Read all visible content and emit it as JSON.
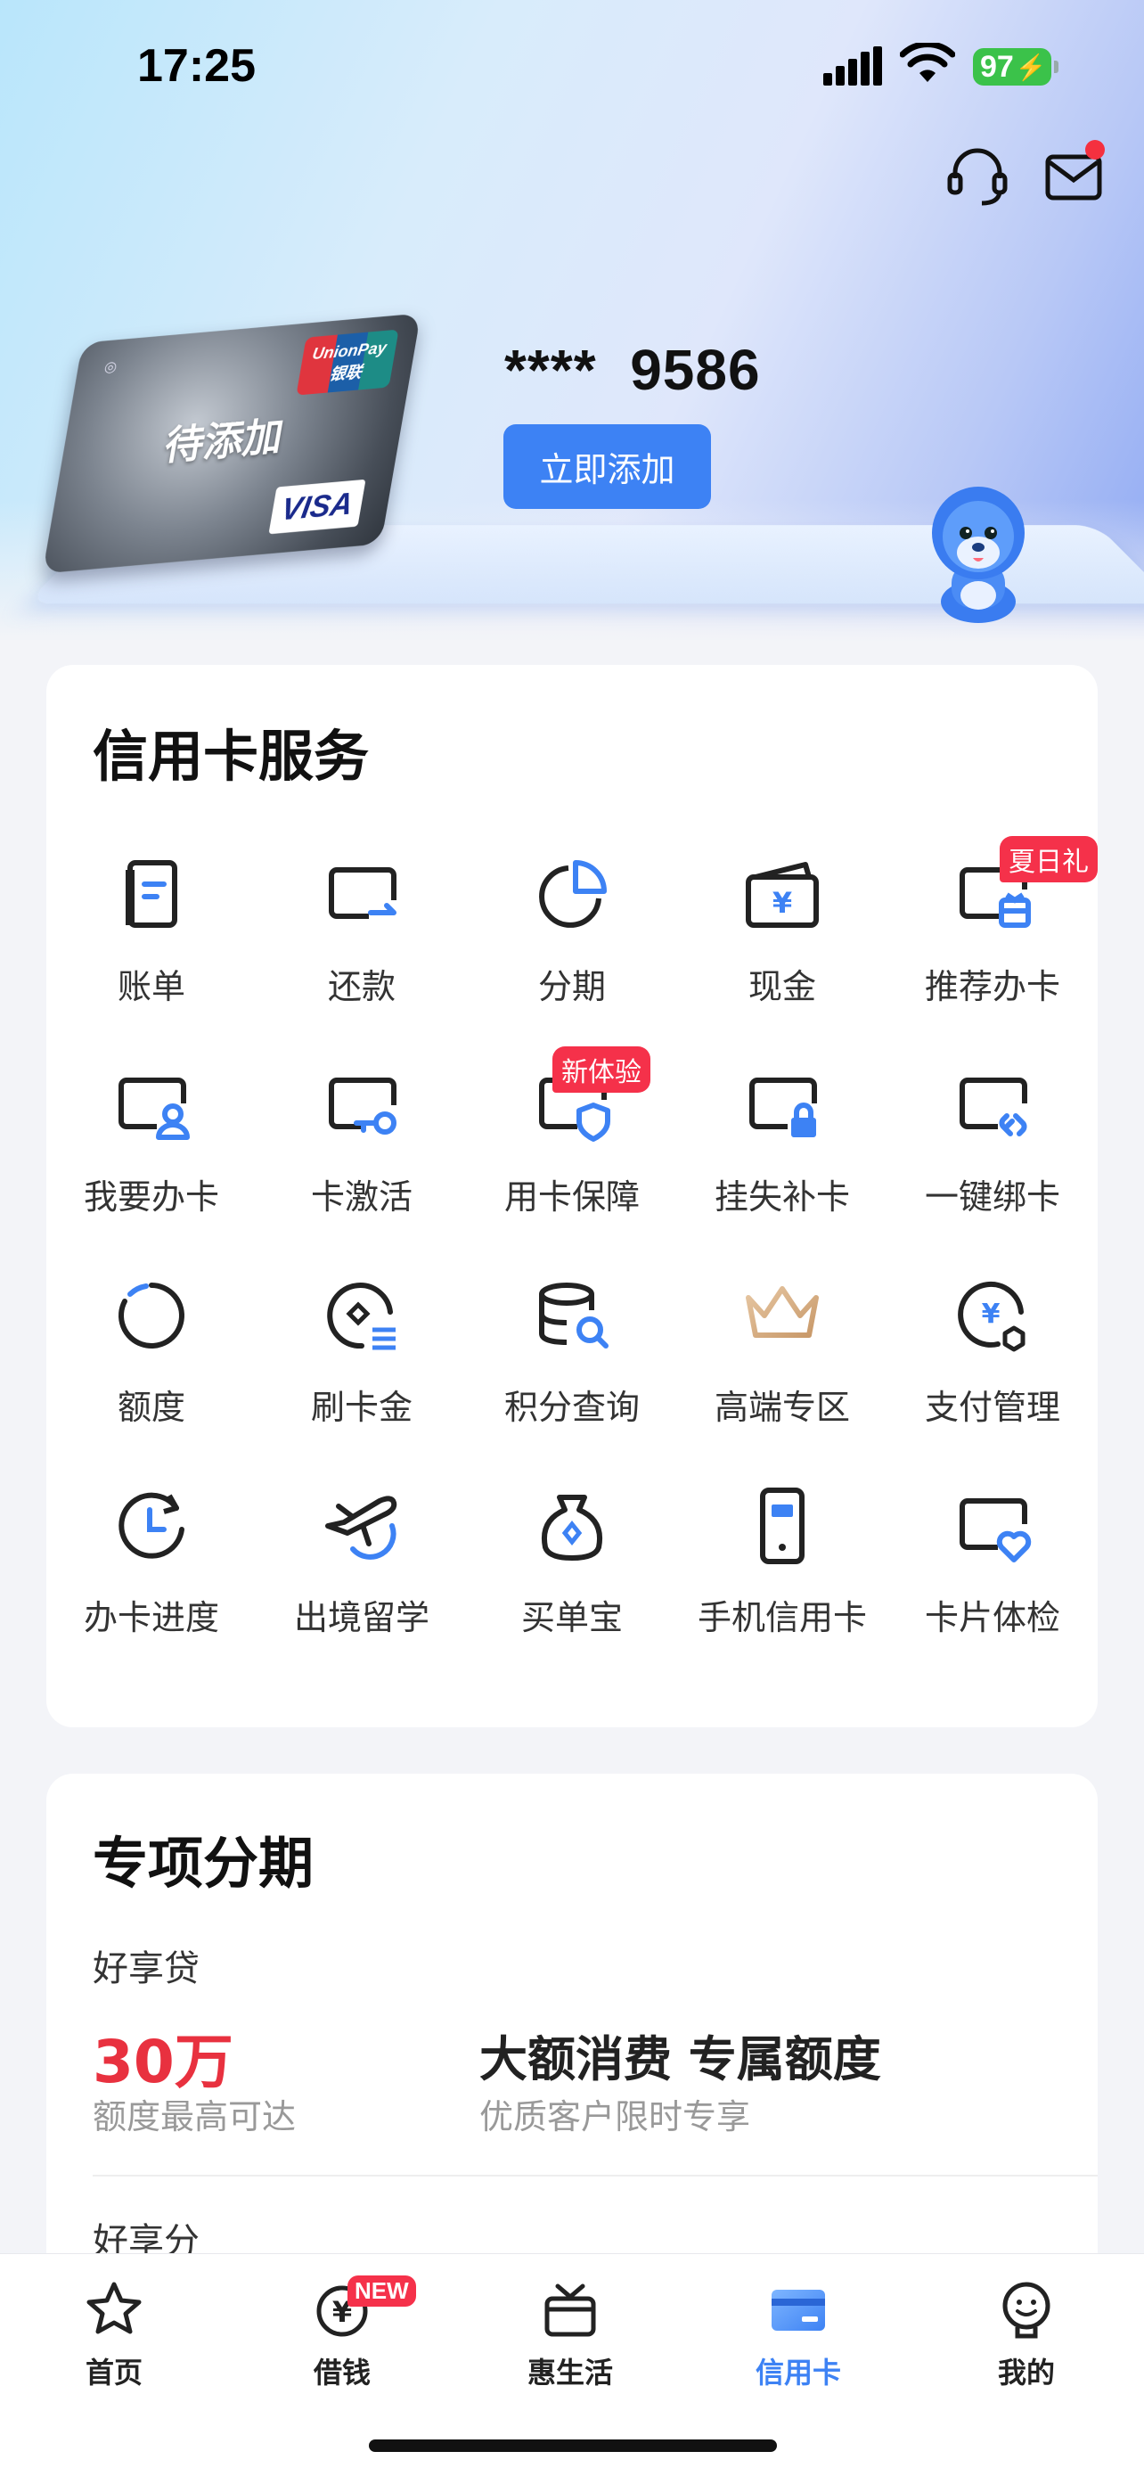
{
  "status_bar": {
    "time": "17:25",
    "battery": "97"
  },
  "header": {
    "support_icon": "headset-icon",
    "mail_icon": "mail-icon"
  },
  "card_area": {
    "card_label": "待添加",
    "card_brand_unionpay": "UnionPay",
    "card_brand_unionpay_cn": "银联",
    "card_brand_visa": "VISA",
    "card_number": "****  9586",
    "add_button": "立即添加"
  },
  "services": {
    "title": "信用卡服务",
    "items": [
      {
        "label": "账单",
        "icon": "bill-icon"
      },
      {
        "label": "还款",
        "icon": "repay-icon"
      },
      {
        "label": "分期",
        "icon": "pie-icon"
      },
      {
        "label": "现金",
        "icon": "cash-wallet-icon"
      },
      {
        "label": "推荐办卡",
        "icon": "recommend-card-icon",
        "tag": "夏日礼"
      },
      {
        "label": "我要办卡",
        "icon": "apply-card-icon"
      },
      {
        "label": "卡激活",
        "icon": "activate-card-icon"
      },
      {
        "label": "用卡保障",
        "icon": "card-protect-icon",
        "tag": "新体验"
      },
      {
        "label": "挂失补卡",
        "icon": "card-lock-icon"
      },
      {
        "label": "一键绑卡",
        "icon": "card-link-icon"
      },
      {
        "label": "额度",
        "icon": "limit-ring-icon"
      },
      {
        "label": "刷卡金",
        "icon": "swipe-bonus-icon"
      },
      {
        "label": "积分查询",
        "icon": "points-search-icon"
      },
      {
        "label": "高端专区",
        "icon": "crown-icon"
      },
      {
        "label": "支付管理",
        "icon": "payment-manage-icon"
      },
      {
        "label": "办卡进度",
        "icon": "progress-clock-icon"
      },
      {
        "label": "出境留学",
        "icon": "plane-icon"
      },
      {
        "label": "买单宝",
        "icon": "money-bag-icon"
      },
      {
        "label": "手机信用卡",
        "icon": "phone-card-icon"
      },
      {
        "label": "卡片体检",
        "icon": "card-health-icon"
      }
    ]
  },
  "installment": {
    "title": "专项分期",
    "product1_name": "好享贷",
    "product1_amount": "30万",
    "product1_sub": "额度最高可达",
    "product1_headline": "大额消费 专属额度",
    "product1_headline_sub": "优质客户限时专享",
    "product2_name": "好享分"
  },
  "tabbar": {
    "items": [
      {
        "label": "首页",
        "icon": "star-icon"
      },
      {
        "label": "借钱",
        "icon": "yuan-coin-icon",
        "badge": "NEW"
      },
      {
        "label": "惠生活",
        "icon": "gift-box-icon"
      },
      {
        "label": "信用卡",
        "icon": "credit-card-icon",
        "active": true
      },
      {
        "label": "我的",
        "icon": "smile-face-icon"
      }
    ]
  },
  "colors": {
    "accent": "#3d82f4",
    "red": "#f5314a",
    "amount_red": "#e8313f"
  }
}
